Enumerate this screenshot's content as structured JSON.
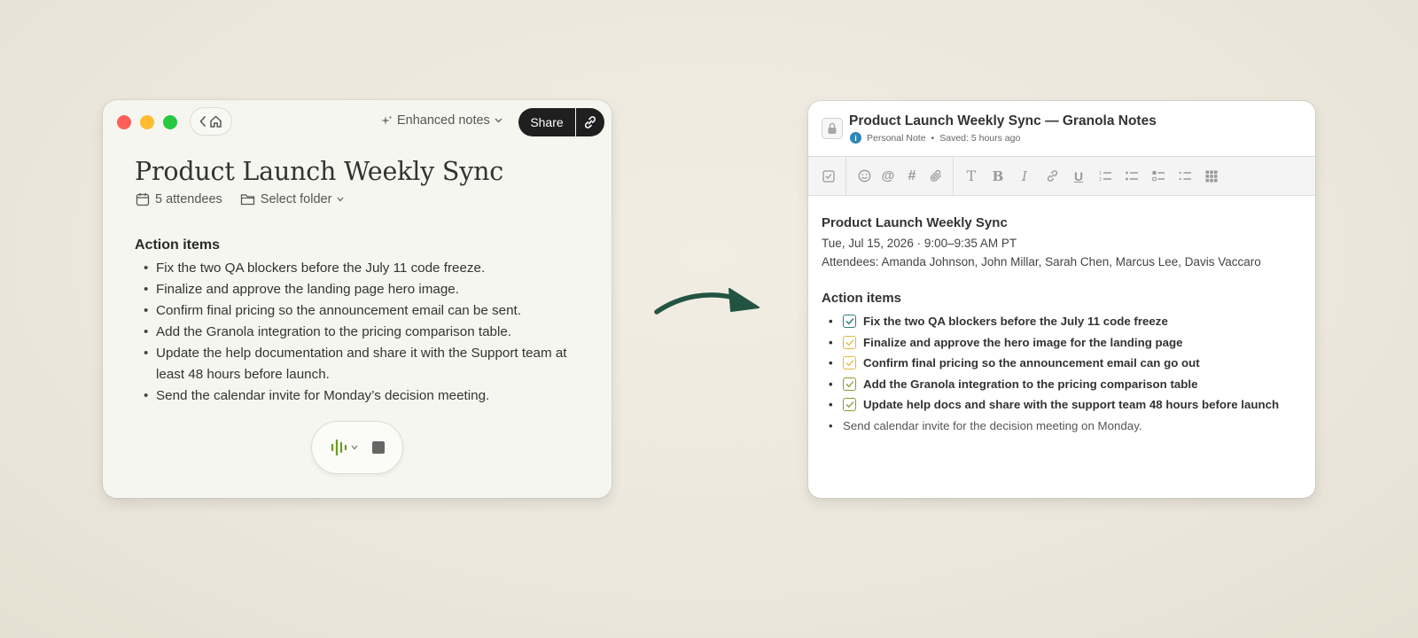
{
  "left_window": {
    "enhanced_label": "Enhanced notes",
    "share_label": "Share",
    "title": "Product Launch Weekly Sync",
    "attendees_label": "5 attendees",
    "folder_label": "Select folder",
    "section_heading": "Action items",
    "items": [
      "Fix the two QA blockers before the July 11 code freeze.",
      "Finalize and approve the landing page hero image.",
      "Confirm final pricing so the announcement email can be sent.",
      "Add the Granola integration to the pricing comparison table.",
      "Update the help documentation and share it with the Support team at least 48 hours before launch.",
      "Send the calendar invite for Monday’s decision meeting."
    ],
    "colors": {
      "accent_green": "#6c9a1f",
      "share_bg": "#1f1f1f"
    }
  },
  "right_window": {
    "title": "Product Launch Weekly Sync — Granola Notes",
    "note_type": "Personal Note",
    "saved_status": "Saved: 5 hours ago",
    "toolbar_icons": [
      "checklist-icon",
      "emoji-icon",
      "mention-icon",
      "hashtag-icon",
      "attachment-icon",
      "text-style-icon",
      "bold-icon",
      "italic-icon",
      "link-icon",
      "underline-icon",
      "numbered-list-icon",
      "bulleted-list-icon",
      "checklist-style-icon",
      "dashed-list-icon",
      "table-icon"
    ],
    "note_name": "Product Launch Weekly Sync",
    "note_date": "Tue, Jul 15, 2026 · 9:00–9:35 AM PT",
    "attendees": "Attendees: Amanda Johnson, John Millar, Sarah Chen, Marcus Lee, Davis Vaccaro",
    "section_heading": "Action items",
    "items": [
      {
        "text": "Fix the two QA blockers before the July 11 code freeze",
        "checkbox": true,
        "color": "#2f7d83"
      },
      {
        "text": "Finalize and approve the hero image for the landing page",
        "checkbox": true,
        "color": "#e2b93b"
      },
      {
        "text": "Confirm final pricing so the announcement email can go out",
        "checkbox": true,
        "color": "#e2b93b"
      },
      {
        "text": "Add the Granola integration to the pricing comparison table",
        "checkbox": true,
        "color": "#8a9a2e"
      },
      {
        "text": "Update help docs and share with the support team 48 hours before launch",
        "checkbox": true,
        "color": "#8a9a2e"
      },
      {
        "text": "Send calendar invite for the decision meeting on Monday.",
        "checkbox": false,
        "color": ""
      }
    ]
  },
  "arrow_color": "#235443"
}
